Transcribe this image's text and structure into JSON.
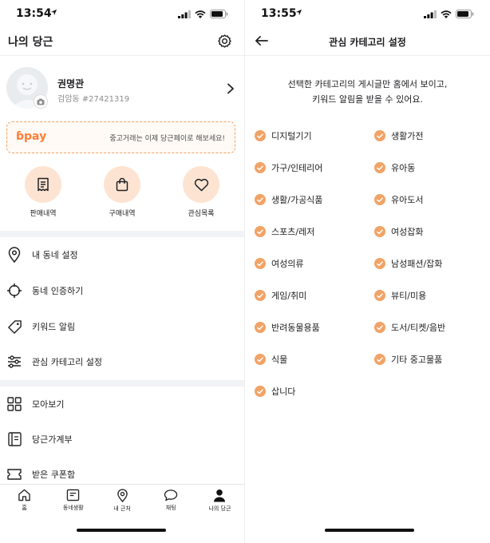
{
  "left": {
    "status": {
      "time": "13:54"
    },
    "header": {
      "title": "나의 당근"
    },
    "profile": {
      "name": "권명관",
      "sub": "검암동 #27421319"
    },
    "pay_banner": {
      "logo": "pay",
      "message": "중고거래는 이제 당근페이로 해보세요!"
    },
    "quick_actions": [
      {
        "label": "판매내역",
        "icon": "receipt-icon"
      },
      {
        "label": "구매내역",
        "icon": "shopping-bag-icon"
      },
      {
        "label": "관심목록",
        "icon": "heart-icon"
      }
    ],
    "menu_group1": [
      {
        "label": "내 동네 설정",
        "icon": "map-pin-icon"
      },
      {
        "label": "동네 인증하기",
        "icon": "target-icon"
      },
      {
        "label": "키워드 알림",
        "icon": "tag-icon"
      },
      {
        "label": "관심 카테고리 설정",
        "icon": "sliders-icon"
      }
    ],
    "menu_group2": [
      {
        "label": "모아보기",
        "icon": "grid-icon"
      },
      {
        "label": "당근가계부",
        "icon": "ledger-icon"
      },
      {
        "label": "받은 쿠폰함",
        "icon": "coupon-icon"
      }
    ],
    "tabs": [
      {
        "label": "홈",
        "icon": "home-icon"
      },
      {
        "label": "동네생활",
        "icon": "community-icon"
      },
      {
        "label": "내 근처",
        "icon": "location-icon"
      },
      {
        "label": "채팅",
        "icon": "chat-icon"
      },
      {
        "label": "나의 당근",
        "icon": "person-icon"
      }
    ]
  },
  "right": {
    "status": {
      "time": "13:55"
    },
    "header": {
      "title": "관심 카테고리 설정"
    },
    "intro": {
      "line1": "선택한 카테고리의 게시글만 홈에서 보이고,",
      "line2": "키워드 알림을 받을 수 있어요."
    },
    "categories": [
      {
        "label": "디지털기기",
        "checked": true
      },
      {
        "label": "생활가전",
        "checked": true
      },
      {
        "label": "가구/인테리어",
        "checked": true
      },
      {
        "label": "유아동",
        "checked": true
      },
      {
        "label": "생활/가공식품",
        "checked": true
      },
      {
        "label": "유아도서",
        "checked": true
      },
      {
        "label": "스포츠/레저",
        "checked": true
      },
      {
        "label": "여성잡화",
        "checked": true
      },
      {
        "label": "여성의류",
        "checked": true
      },
      {
        "label": "남성패션/잡화",
        "checked": true
      },
      {
        "label": "게임/취미",
        "checked": true
      },
      {
        "label": "뷰티/미용",
        "checked": true
      },
      {
        "label": "반려동물용품",
        "checked": true
      },
      {
        "label": "도서/티켓/음반",
        "checked": true
      },
      {
        "label": "식물",
        "checked": true
      },
      {
        "label": "기타 중고물품",
        "checked": true
      },
      {
        "label": "삽니다",
        "checked": true
      }
    ]
  },
  "colors": {
    "accent": "#ff7e36",
    "check": "#f2a366",
    "quick_bg": "#fde4d2",
    "separator": "#f2f3f6"
  }
}
